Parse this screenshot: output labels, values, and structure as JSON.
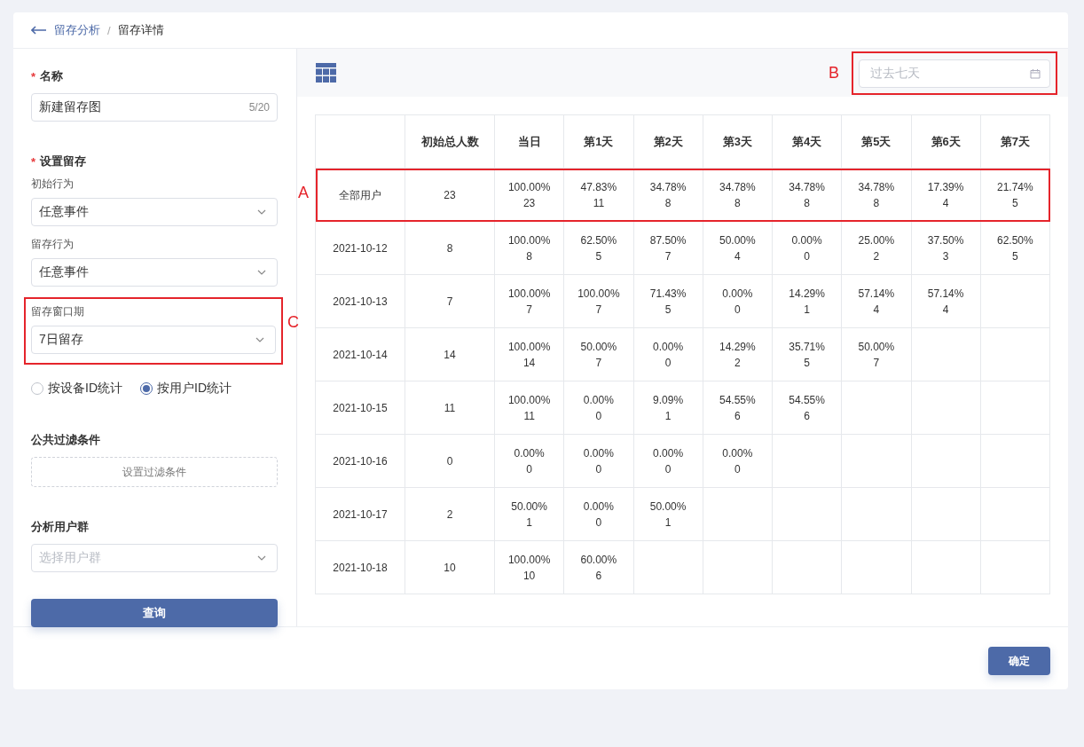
{
  "breadcrumb": {
    "parent": "留存分析",
    "separator": "/",
    "current": "留存详情"
  },
  "form": {
    "name": {
      "mark": "*",
      "label": "名称",
      "value": "新建留存图",
      "counter": "5/20"
    },
    "retention": {
      "mark": "*",
      "label": "设置留存",
      "fields": [
        {
          "label": "初始行为",
          "value": "任意事件"
        },
        {
          "label": "留存行为",
          "value": "任意事件"
        },
        {
          "label": "留存窗口期",
          "value": "7日留存",
          "annotation": "C"
        }
      ]
    },
    "count_by": [
      {
        "label": "按设备ID统计",
        "selected": false
      },
      {
        "label": "按用户ID统计",
        "selected": true
      }
    ],
    "filter": {
      "label": "公共过滤条件",
      "button": "设置过滤条件"
    },
    "user_group": {
      "label": "分析用户群",
      "placeholder": "选择用户群"
    },
    "query_button": "查询"
  },
  "toolbar": {
    "date_range": {
      "placeholder": "过去七天",
      "annotation": "B"
    }
  },
  "table": {
    "columns": [
      "",
      "初始总人数",
      "当日",
      "第1天",
      "第2天",
      "第3天",
      "第4天",
      "第5天",
      "第6天",
      "第7天"
    ],
    "rows": [
      {
        "annotation": "A",
        "cells": [
          {
            "kind": "label",
            "text": "全部用户"
          },
          {
            "kind": "number",
            "text": "23"
          },
          {
            "kind": "retention",
            "pct": "100.00%",
            "count": "23"
          },
          {
            "kind": "retention",
            "pct": "47.83%",
            "count": "11"
          },
          {
            "kind": "retention",
            "pct": "34.78%",
            "count": "8"
          },
          {
            "kind": "retention",
            "pct": "34.78%",
            "count": "8"
          },
          {
            "kind": "retention",
            "pct": "34.78%",
            "count": "8"
          },
          {
            "kind": "retention",
            "pct": "34.78%",
            "count": "8"
          },
          {
            "kind": "retention",
            "pct": "17.39%",
            "count": "4"
          },
          {
            "kind": "retention",
            "pct": "21.74%",
            "count": "5"
          }
        ]
      },
      {
        "cells": [
          {
            "kind": "label",
            "text": "2021-10-12"
          },
          {
            "kind": "number",
            "text": "8"
          },
          {
            "kind": "retention",
            "pct": "100.00%",
            "count": "8"
          },
          {
            "kind": "retention",
            "pct": "62.50%",
            "count": "5"
          },
          {
            "kind": "retention",
            "pct": "87.50%",
            "count": "7"
          },
          {
            "kind": "retention",
            "pct": "50.00%",
            "count": "4"
          },
          {
            "kind": "retention",
            "pct": "0.00%",
            "count": "0"
          },
          {
            "kind": "retention",
            "pct": "25.00%",
            "count": "2"
          },
          {
            "kind": "retention",
            "pct": "37.50%",
            "count": "3"
          },
          {
            "kind": "retention",
            "pct": "62.50%",
            "count": "5"
          }
        ]
      },
      {
        "cells": [
          {
            "kind": "label",
            "text": "2021-10-13"
          },
          {
            "kind": "number",
            "text": "7"
          },
          {
            "kind": "retention",
            "pct": "100.00%",
            "count": "7"
          },
          {
            "kind": "retention",
            "pct": "100.00%",
            "count": "7"
          },
          {
            "kind": "retention",
            "pct": "71.43%",
            "count": "5"
          },
          {
            "kind": "retention",
            "pct": "0.00%",
            "count": "0"
          },
          {
            "kind": "retention",
            "pct": "14.29%",
            "count": "1"
          },
          {
            "kind": "retention",
            "pct": "57.14%",
            "count": "4"
          },
          {
            "kind": "retention",
            "pct": "57.14%",
            "count": "4"
          }
        ]
      },
      {
        "cells": [
          {
            "kind": "label",
            "text": "2021-10-14"
          },
          {
            "kind": "number",
            "text": "14"
          },
          {
            "kind": "retention",
            "pct": "100.00%",
            "count": "14"
          },
          {
            "kind": "retention",
            "pct": "50.00%",
            "count": "7"
          },
          {
            "kind": "retention",
            "pct": "0.00%",
            "count": "0"
          },
          {
            "kind": "retention",
            "pct": "14.29%",
            "count": "2"
          },
          {
            "kind": "retention",
            "pct": "35.71%",
            "count": "5"
          },
          {
            "kind": "retention",
            "pct": "50.00%",
            "count": "7"
          }
        ]
      },
      {
        "cells": [
          {
            "kind": "label",
            "text": "2021-10-15"
          },
          {
            "kind": "number",
            "text": "11"
          },
          {
            "kind": "retention",
            "pct": "100.00%",
            "count": "11"
          },
          {
            "kind": "retention",
            "pct": "0.00%",
            "count": "0"
          },
          {
            "kind": "retention",
            "pct": "9.09%",
            "count": "1"
          },
          {
            "kind": "retention",
            "pct": "54.55%",
            "count": "6"
          },
          {
            "kind": "retention",
            "pct": "54.55%",
            "count": "6"
          }
        ]
      },
      {
        "cells": [
          {
            "kind": "label",
            "text": "2021-10-16"
          },
          {
            "kind": "number",
            "text": "0"
          },
          {
            "kind": "retention",
            "pct": "0.00%",
            "count": "0"
          },
          {
            "kind": "retention",
            "pct": "0.00%",
            "count": "0"
          },
          {
            "kind": "retention",
            "pct": "0.00%",
            "count": "0"
          },
          {
            "kind": "retention",
            "pct": "0.00%",
            "count": "0"
          }
        ]
      },
      {
        "cells": [
          {
            "kind": "label",
            "text": "2021-10-17"
          },
          {
            "kind": "number",
            "text": "2"
          },
          {
            "kind": "retention",
            "pct": "50.00%",
            "count": "1"
          },
          {
            "kind": "retention",
            "pct": "0.00%",
            "count": "0"
          },
          {
            "kind": "retention",
            "pct": "50.00%",
            "count": "1"
          }
        ]
      },
      {
        "cells": [
          {
            "kind": "label",
            "text": "2021-10-18"
          },
          {
            "kind": "number",
            "text": "10"
          },
          {
            "kind": "retention",
            "pct": "100.00%",
            "count": "10"
          },
          {
            "kind": "retention",
            "pct": "60.00%",
            "count": "6"
          }
        ]
      }
    ]
  },
  "confirm_button": "确定"
}
